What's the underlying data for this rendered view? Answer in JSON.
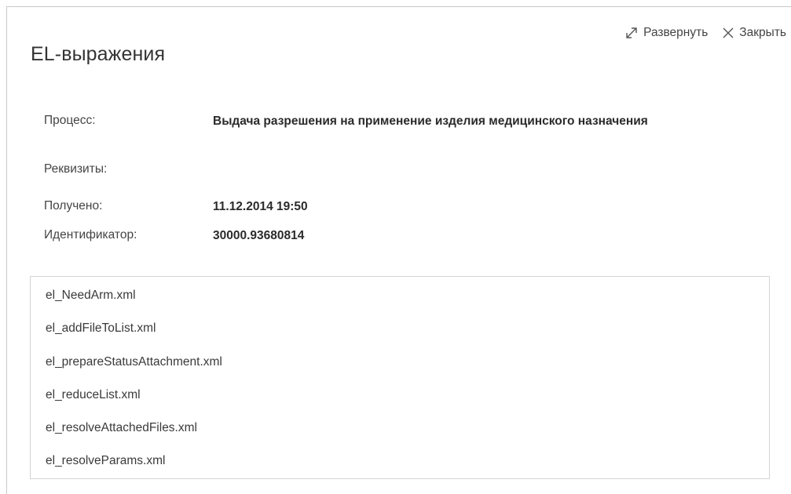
{
  "dialog": {
    "title": "EL-выражения",
    "expand_label": "Развернуть",
    "close_label": "Закрыть"
  },
  "info": {
    "process_label": "Процесс:",
    "process_value": "Выдача разрешения на применение изделия медицинского назначения",
    "requisites_label": "Реквизиты:",
    "requisites_value": "",
    "received_label": "Получено:",
    "received_value": "11.12.2014 19:50",
    "id_label": "Идентификатор:",
    "id_value": "30000.93680814"
  },
  "files": [
    "el_NeedArm.xml",
    "el_addFileToList.xml",
    "el_prepareStatusAttachment.xml",
    "el_reduceList.xml",
    "el_resolveAttachedFiles.xml",
    "el_resolveParams.xml"
  ],
  "icons": {
    "expand": "expand-arrows-icon",
    "close": "close-x-icon"
  }
}
